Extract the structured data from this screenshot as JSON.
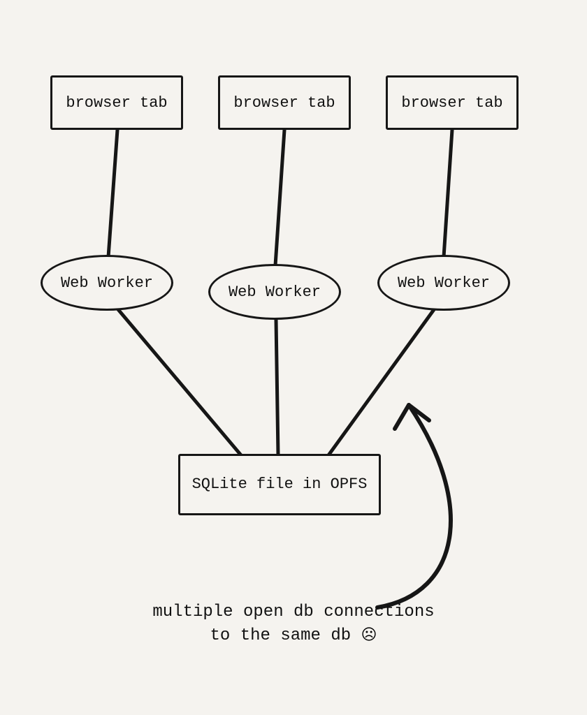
{
  "nodes": {
    "tab1": "browser tab",
    "tab2": "browser tab",
    "tab3": "browser tab",
    "worker1": "Web Worker",
    "worker2": "Web Worker",
    "worker3": "Web Worker",
    "db": "SQLite file in OPFS"
  },
  "caption": {
    "line1": "multiple open db connections",
    "line2": "to the same db",
    "emoji": "☹"
  },
  "edges": [
    {
      "from": "tab1",
      "to": "worker1"
    },
    {
      "from": "tab2",
      "to": "worker2"
    },
    {
      "from": "tab3",
      "to": "worker3"
    },
    {
      "from": "worker1",
      "to": "db"
    },
    {
      "from": "worker2",
      "to": "db"
    },
    {
      "from": "worker3",
      "to": "db"
    }
  ],
  "annotation_arrow": {
    "from": "caption",
    "to": "edge:worker3-db"
  }
}
